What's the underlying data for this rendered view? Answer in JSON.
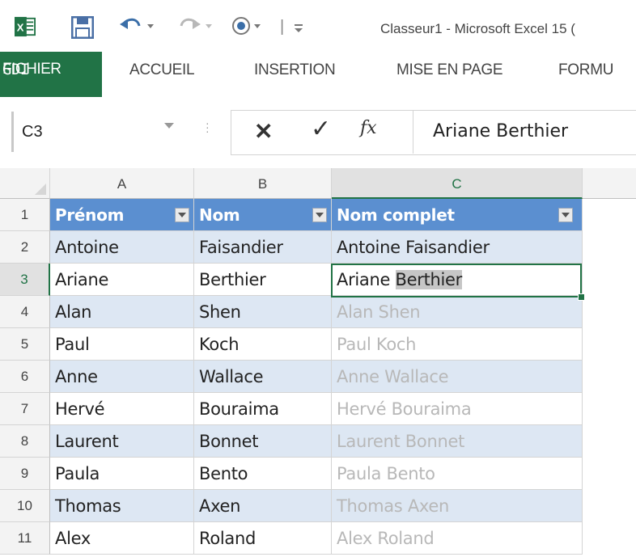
{
  "window": {
    "title": "Classeur1 - Microsoft Excel 15 (",
    "qat_separator": "|"
  },
  "ribbon": {
    "tabs": [
      "FICHIER",
      "ACCUEIL",
      "INSERTION",
      "MISE EN PAGE",
      "FORMU"
    ],
    "gdi_label": "GDI"
  },
  "formula_bar": {
    "name_box": "C3",
    "cancel_label": "✕",
    "enter_label": "✓",
    "fx_label": "fx",
    "formula": "Ariane Berthier"
  },
  "grid": {
    "columns": [
      "A",
      "B",
      "C"
    ],
    "rows": [
      1,
      2,
      3,
      4,
      5,
      6,
      7,
      8,
      9,
      10,
      11
    ],
    "active_cell": "C3",
    "table_header": [
      "Prénom",
      "Nom",
      "Nom complet"
    ],
    "data": [
      {
        "prenom": "Antoine",
        "nom": "Faisandier",
        "complet": "Antoine Faisandier"
      },
      {
        "prenom": "Ariane",
        "nom": "Berthier",
        "complet": "Ariane ",
        "complet_suggest": "Berthier"
      },
      {
        "prenom": "Alan",
        "nom": "Shen",
        "complet": "Alan Shen"
      },
      {
        "prenom": "Paul",
        "nom": "Koch",
        "complet": "Paul Koch"
      },
      {
        "prenom": "Anne",
        "nom": "Wallace",
        "complet": "Anne Wallace"
      },
      {
        "prenom": "Hervé",
        "nom": "Bouraima",
        "complet": "Hervé Bouraima"
      },
      {
        "prenom": "Laurent",
        "nom": "Bonnet",
        "complet": "Laurent Bonnet"
      },
      {
        "prenom": "Paula",
        "nom": "Bento",
        "complet": "Paula Bento"
      },
      {
        "prenom": "Thomas",
        "nom": "Axen",
        "complet": "Thomas Axen"
      },
      {
        "prenom": "Alex",
        "nom": "Roland",
        "complet": "Alex Roland"
      }
    ]
  },
  "colors": {
    "excel_green": "#217346",
    "table_header_blue": "#5b8fd0",
    "table_band": "#dde7f3",
    "flash_fill_preview": "#b8b8b8"
  }
}
